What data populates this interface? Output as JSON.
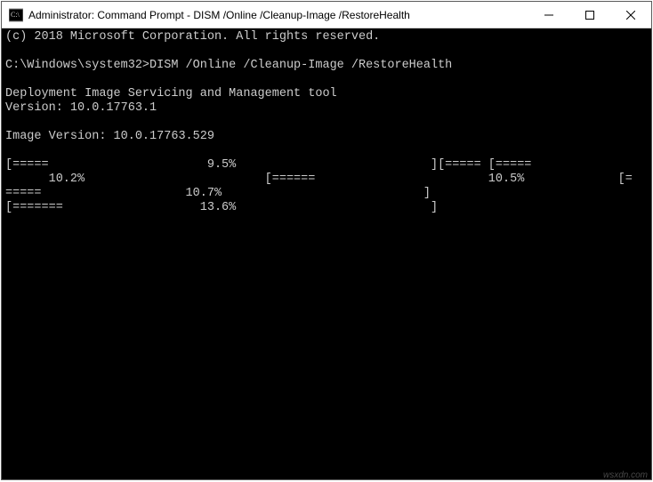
{
  "titlebar": {
    "title": "Administrator: Command Prompt - DISM  /Online /Cleanup-Image /RestoreHealth",
    "icon_name": "cmd-icon",
    "minimize_label": "Minimize",
    "maximize_label": "Maximize",
    "close_label": "Close"
  },
  "terminal": {
    "copyright": "(c) 2018 Microsoft Corporation. All rights reserved.",
    "prompt_path": "C:\\Windows\\system32>",
    "command": "DISM /Online /Cleanup-Image /RestoreHealth",
    "tool_header": "Deployment Image Servicing and Management tool",
    "tool_version_label": "Version:",
    "tool_version": "10.0.17763.1",
    "image_version_label": "Image Version:",
    "image_version": "10.0.17763.529",
    "progress_lines": [
      "[=====                      9.5%                           ][===== [=====               ",
      "      10.2%                         [======                        10.5%             [=",
      "=====                    10.7%                            ]",
      "[=======                   13.6%                           ]"
    ]
  },
  "watermark": "wsxdn.com"
}
